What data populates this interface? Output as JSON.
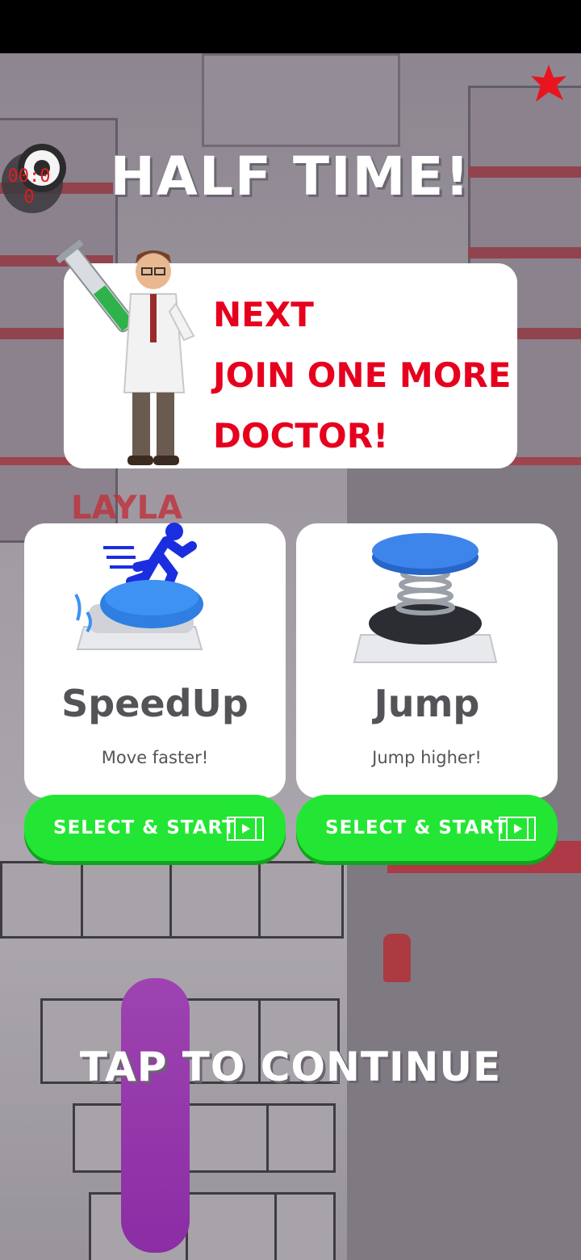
{
  "hud": {
    "timer": "00:00",
    "timer_line1": "00:0",
    "timer_line2": "0",
    "star_icon": "red-star-icon"
  },
  "title": "HALF TIME!",
  "next_card": {
    "line1": "NEXT",
    "line2": "JOIN ONE MORE",
    "line3": "DOCTOR!",
    "text_color": "#e6001e",
    "character_icon": "doctor-with-syringe-icon"
  },
  "background_label": "LAYLA",
  "boosts": [
    {
      "title": "SpeedUp",
      "subtitle": "Move faster!",
      "button_label": "SELECT & START",
      "icon": "speedup-button-icon"
    },
    {
      "title": "Jump",
      "subtitle": "Jump higher!",
      "button_label": "SELECT & START",
      "icon": "jump-spring-button-icon"
    }
  ],
  "tap_to_continue": "TAP TO CONTINUE",
  "colors": {
    "button_green": "#22e633",
    "title_white": "#ffffff",
    "accent_red": "#e6001e",
    "icon_blue": "#2f7fe3"
  }
}
